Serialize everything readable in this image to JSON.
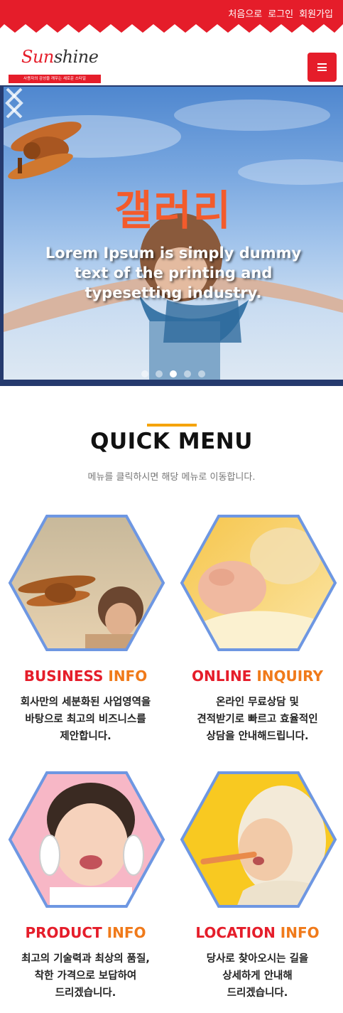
{
  "top_links": [
    "처음으로",
    "로그인",
    "회원가입"
  ],
  "logo": {
    "name_part1": "Sun",
    "name_part2": "shine",
    "tagline": "사용자의 감성을 깨우는 새로운 스타일"
  },
  "menu_button_icon": "hamburger-icon",
  "hero": {
    "title": "갤러리",
    "text": "Lorem Ipsum is simply dummy text of the printing and typesetting industry.",
    "slide_count": 5,
    "active_slide": 3
  },
  "quick_menu": {
    "title": "QUICK MENU",
    "subtitle": "메뉴를 클릭하시면 해당 메뉴로 이동합니다.",
    "items": [
      {
        "title_a": "BUSINESS ",
        "title_b": "INFO",
        "desc": [
          "회사만의 세분화된 사업영역을",
          "바탕으로 최고의 비즈니스를",
          "제안합니다."
        ]
      },
      {
        "title_a": "ONLINE ",
        "title_b": "INQUIRY",
        "desc": [
          "온라인 무료상담 및",
          "견적받기로 빠르고 효율적인",
          "상담을 안내해드립니다."
        ]
      },
      {
        "title_a": "PRODUCT ",
        "title_b": "INFO",
        "desc": [
          "최고의 기술력과 최상의 품질,",
          "착한 가격으로 보답하여",
          "드리겠습니다."
        ]
      },
      {
        "title_a": "LOCATION ",
        "title_b": "INFO",
        "desc": [
          "당사로 찾아오시는 길을",
          "상세하게 안내해",
          "드리겠습니다."
        ]
      }
    ]
  },
  "colors": {
    "brand_red": "#e51d2a",
    "accent_orange": "#f07a1a",
    "hex_border": "#6e97e2",
    "accent_bar": "#f5a300"
  }
}
